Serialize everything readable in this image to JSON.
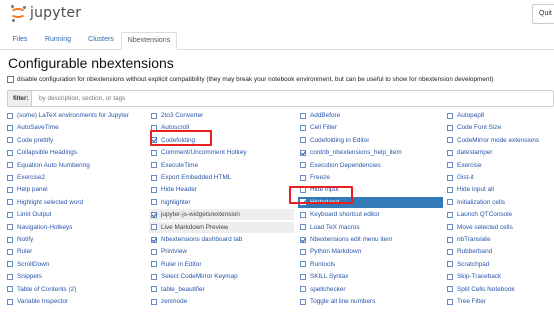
{
  "header": {
    "app_name": "jupyter",
    "quit_label": "Quit"
  },
  "tabs": [
    {
      "label": "Files",
      "active": false
    },
    {
      "label": "Running",
      "active": false
    },
    {
      "label": "Clusters",
      "active": false
    },
    {
      "label": "Nbextensions",
      "active": true
    }
  ],
  "page_title": "Configurable nbextensions",
  "compat_option": {
    "label": "disable configuration for nbextensions without explicit compatibility (they may break your notebook environment, but can be useful to show for nbextension development)",
    "checked": false
  },
  "filter": {
    "label": "filter:",
    "placeholder": "by description, section, or tags"
  },
  "columns": [
    [
      {
        "label": "(some) LaTeX environments for Jupyter",
        "checked": false
      },
      {
        "label": "AutoSaveTime",
        "checked": false
      },
      {
        "label": "Code prettify",
        "checked": false
      },
      {
        "label": "Collapsible Headings",
        "checked": false
      },
      {
        "label": "Equation Auto Numbering",
        "checked": false
      },
      {
        "label": "Exercise2",
        "checked": false
      },
      {
        "label": "Help panel",
        "checked": false
      },
      {
        "label": "Highlight selected word",
        "checked": false
      },
      {
        "label": "Limit Output",
        "checked": false
      },
      {
        "label": "Navigation-Hotkeys",
        "checked": false
      },
      {
        "label": "Notify",
        "checked": false
      },
      {
        "label": "Ruler",
        "checked": false
      },
      {
        "label": "ScrollDown",
        "checked": false
      },
      {
        "label": "Snippets",
        "checked": false
      },
      {
        "label": "Table of Contents (2)",
        "checked": false
      },
      {
        "label": "Variable Inspector",
        "checked": false
      }
    ],
    [
      {
        "label": "2to3 Converter",
        "checked": false
      },
      {
        "label": "Autoscroll",
        "checked": false
      },
      {
        "label": "Codefolding",
        "checked": true
      },
      {
        "label": "Comment/Uncomment Hotkey",
        "checked": false
      },
      {
        "label": "ExecuteTime",
        "checked": false
      },
      {
        "label": "Export Embedded HTML",
        "checked": false
      },
      {
        "label": "Hide Header",
        "checked": false
      },
      {
        "label": "highlighter",
        "checked": false
      },
      {
        "label": "jupyter-js-widgets/extension",
        "checked": true,
        "state": "disabled"
      },
      {
        "label": "Live Markdown Preview",
        "checked": false,
        "state": "disabled"
      },
      {
        "label": "Nbextensions dashboard tab",
        "checked": true
      },
      {
        "label": "Printview",
        "checked": false
      },
      {
        "label": "Ruler in Editor",
        "checked": false
      },
      {
        "label": "Select CodeMirror Keymap",
        "checked": false
      },
      {
        "label": "table_beautifier",
        "checked": false
      },
      {
        "label": "zenmode",
        "checked": false
      }
    ],
    [
      {
        "label": "AddBefore",
        "checked": false
      },
      {
        "label": "Cell Filter",
        "checked": false
      },
      {
        "label": "Codefolding in Editor",
        "checked": false
      },
      {
        "label": "contrib_nbextensions_help_item",
        "checked": true
      },
      {
        "label": "Execution Dependencies",
        "checked": false
      },
      {
        "label": "Freeze",
        "checked": false
      },
      {
        "label": "Hide input",
        "checked": false
      },
      {
        "label": "Hinterland",
        "checked": true,
        "state": "selected"
      },
      {
        "label": "Keyboard shortcut editor",
        "checked": false
      },
      {
        "label": "Load TeX macros",
        "checked": false
      },
      {
        "label": "Nbextensions edit menu item",
        "checked": true
      },
      {
        "label": "Python Markdown",
        "checked": false
      },
      {
        "label": "Runtools",
        "checked": false
      },
      {
        "label": "SKILL Syntax",
        "checked": false
      },
      {
        "label": "spellchecker",
        "checked": false
      },
      {
        "label": "Toggle all line numbers",
        "checked": false
      }
    ],
    [
      {
        "label": "Autopep8",
        "checked": false
      },
      {
        "label": "Code Font Size",
        "checked": false
      },
      {
        "label": "CodeMirror mode extensions",
        "checked": false
      },
      {
        "label": "datestamper",
        "checked": false
      },
      {
        "label": "Exercise",
        "checked": false
      },
      {
        "label": "Gist-it",
        "checked": false
      },
      {
        "label": "Hide input all",
        "checked": false
      },
      {
        "label": "Initialization cells",
        "checked": false
      },
      {
        "label": "Launch QTConsole",
        "checked": false
      },
      {
        "label": "Move selected cells",
        "checked": false
      },
      {
        "label": "nbTranslate",
        "checked": false
      },
      {
        "label": "Rubberband",
        "checked": false
      },
      {
        "label": "Scratchpad",
        "checked": false
      },
      {
        "label": "Skip-Traceback",
        "checked": false
      },
      {
        "label": "Split Cells Notebook",
        "checked": false
      },
      {
        "label": "Tree Filter",
        "checked": false
      }
    ]
  ],
  "highlight_color": "#e8201f",
  "accent_color": "#337ab7"
}
